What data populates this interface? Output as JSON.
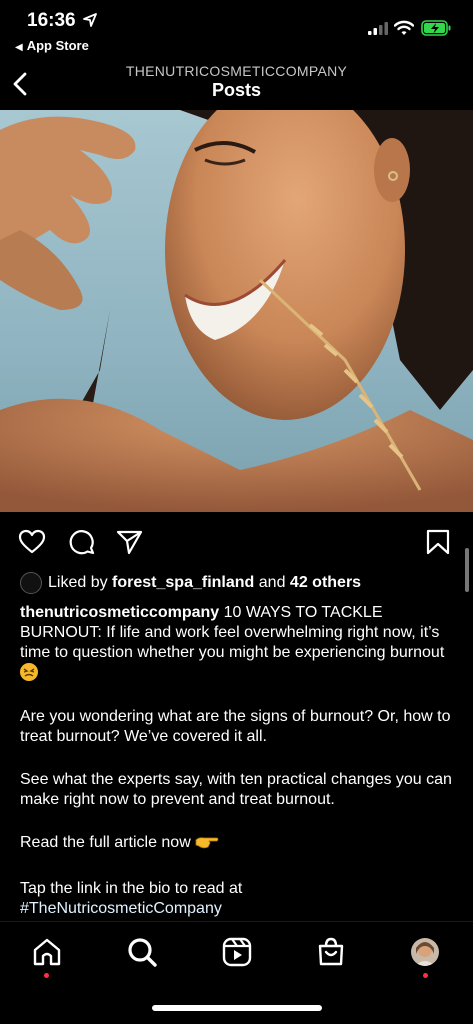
{
  "status_bar": {
    "time": "16:36",
    "back_app": "App Store",
    "back_arrow": "◀"
  },
  "header": {
    "account": "THENUTRICOSMETICCOMPANY",
    "title": "Posts",
    "back_icon": "chevron-left-icon"
  },
  "post": {
    "photo_alt": "photo",
    "likes": {
      "prefix": "Liked by",
      "user": "forest_spa_finland",
      "conjunction": "and",
      "others": "42 others"
    },
    "caption": {
      "username": "thenutricosmeticcompany",
      "text1": "10 WAYS TO TACKLE BURNOUT: If life and work feel overwhelming right now, it’s time to question whether you might be experiencing burnout",
      "text2": "Are you wondering what are the signs of burnout? Or, how to treat burnout? We’ve covered it all.",
      "text3": "See what the experts say, with ten practical changes you can make right now to prevent and treat burnout.",
      "text4": "Read the full article now",
      "text5": "Tap the link in the bio to read at",
      "hashtag": "#TheNutricosmeticCompany"
    }
  },
  "nav": {
    "items": [
      "home-icon",
      "search-icon",
      "reels-icon",
      "shop-icon",
      "profile-avatar"
    ]
  },
  "colors": {
    "background": "#000000",
    "notification_dot": "#ff3040",
    "battery": "#32d74b"
  }
}
